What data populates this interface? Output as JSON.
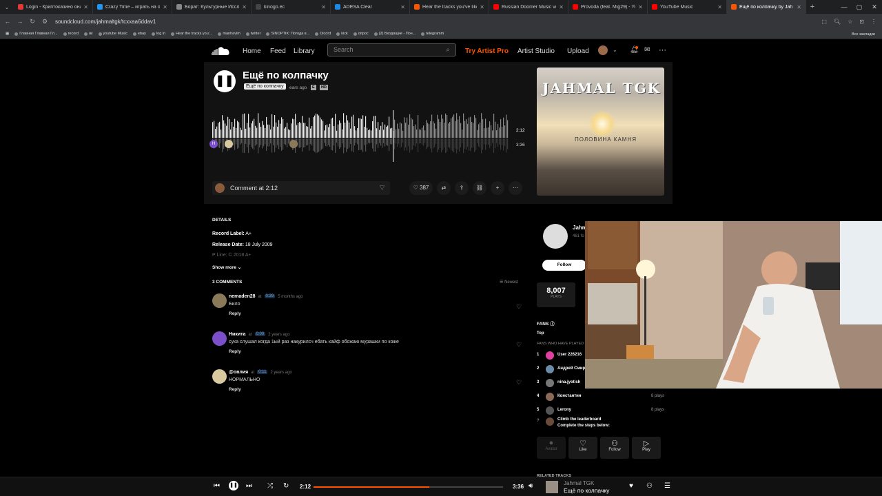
{
  "browser": {
    "tabs": [
      {
        "title": "Login - Криптоказино онлай",
        "color": "#e53935"
      },
      {
        "title": "Crazy Time – играть на офиц",
        "color": "#2196f3"
      },
      {
        "title": "Борат: Культурные Исследо",
        "color": "#888888"
      },
      {
        "title": "kinogo.ec",
        "color": "#444444"
      },
      {
        "title": "ADESA Clear",
        "color": "#1e88e5"
      },
      {
        "title": "Hear the tracks you've liked: o",
        "color": "#ff5500"
      },
      {
        "title": "Russian Doomer Music vol.3 (",
        "color": "#ff0000"
      },
      {
        "title": "Provoda (feat. Mig29) - YouT",
        "color": "#ff0000"
      },
      {
        "title": "YouTube Music",
        "color": "#ff0000"
      },
      {
        "title": "Ещё по колпачку by Jah",
        "color": "#ff5500"
      }
    ],
    "url": "soundcloud.com/jahmaltgk/tcxxaa6ddav1",
    "bookmarks": [
      "Главная Главная Гл...",
      "record",
      "вк",
      "youtube Music",
      "ebay",
      "log in",
      "Hear the tracks you'...",
      "manhavim",
      "twitter",
      "SINOPTIK: Погода в...",
      "Dicord",
      "kick",
      "опрос",
      "(2) Входящие - Поч...",
      "telegramm"
    ],
    "bookmarks_right": "Все закладки"
  },
  "header": {
    "home": "Home",
    "feed": "Feed",
    "library": "Library",
    "search_placeholder": "Search",
    "try_pro": "Try Artist Pro",
    "artist_studio": "Artist Studio",
    "upload": "Upload"
  },
  "track": {
    "title": "Ещё по колпачку",
    "tooltip": "Ещё по колпачку",
    "age": "ears ago",
    "badge_e": "E",
    "badge_hd": "HD",
    "time_current": "2:12",
    "time_total": "3:36",
    "comment_placeholder": "Comment at 2:12",
    "likes": "387"
  },
  "art": {
    "title": "JAHMAL TGK",
    "subtitle": "ПОЛОВИНА КАМНЯ"
  },
  "details": {
    "heading": "DETAILS",
    "record_label_key": "Record Label:",
    "record_label": "A+",
    "release_key": "Release Date:",
    "release": "18 July 2009",
    "pline": "P Line: © 2018 A+",
    "show_more": "Show more"
  },
  "comments": {
    "heading": "3 COMMENTS",
    "sort": "Newest",
    "items": [
      {
        "user": "nemaden28",
        "at": "at",
        "time": "0:39",
        "age": "5 months ago",
        "text": "Било",
        "reply": "Reply",
        "avatar": "#8a7a5a"
      },
      {
        "user": "Никита",
        "at": "at",
        "time": "0:00",
        "age": "2 years ago",
        "text": "сука слушал когда 1ый раз накурилсч ебать кайф обожаю мурашки по коже",
        "reply": "Reply",
        "avatar": "#7b4fc9"
      },
      {
        "user": "@oвлия",
        "at": "at",
        "time": "0:11",
        "age": "2 years ago",
        "text": "НОРМАЛЬНО",
        "reply": "Reply",
        "avatar": "#d9c9a0"
      }
    ]
  },
  "artist": {
    "name": "Jahm",
    "followers": "461 fo",
    "follow": "Follow",
    "plays": "8,007",
    "plays_label": "PLAYS"
  },
  "fans": {
    "heading": "FANS",
    "top": "Top",
    "sub": "FANS WHO HAVE PLAYED",
    "list": [
      {
        "n": "1",
        "name": "User 226216",
        "plays": "",
        "color": "#e040a0"
      },
      {
        "n": "2",
        "name": "Андрей Смир",
        "plays": "",
        "color": "#6a8ca8"
      },
      {
        "n": "3",
        "name": "nina.jyotish",
        "plays": "",
        "color": "#777777"
      },
      {
        "n": "4",
        "name": "Константин",
        "plays": "8 plays",
        "color": "#8b6a55"
      },
      {
        "n": "5",
        "name": "Lerony",
        "plays": "8 plays",
        "color": "#555555"
      }
    ],
    "climb_n": "?",
    "climb_title": "Climb the leaderboard",
    "climb_sub": "Complete the steps below:"
  },
  "actions": {
    "avatar": "Avatar",
    "like": "Like",
    "follow": "Follow",
    "play": "Play"
  },
  "related": "RELATED TRACKS",
  "player": {
    "current": "2:12",
    "total": "3:36",
    "progress": 0.61,
    "artist": "Jahmal TGK",
    "title": "Ещё по колпачку"
  }
}
